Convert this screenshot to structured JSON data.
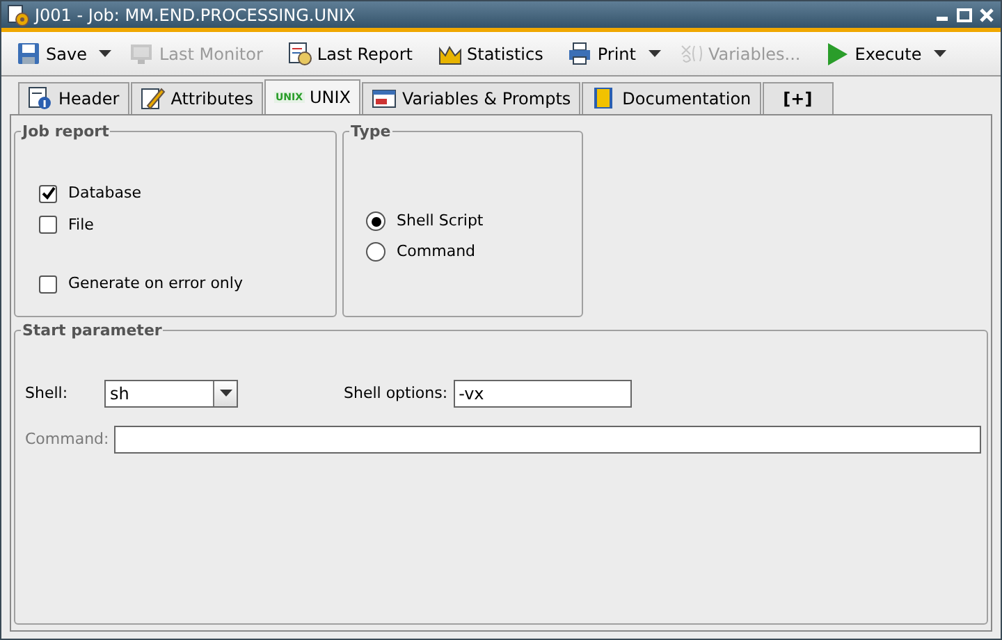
{
  "window": {
    "title": "J001 - Job: MM.END.PROCESSING.UNIX"
  },
  "toolbar": [
    {
      "label": "Save",
      "disabled": false,
      "dropdown": true
    },
    {
      "label": "Last Monitor",
      "disabled": true,
      "dropdown": false
    },
    {
      "label": "Last Report",
      "disabled": false,
      "dropdown": false
    },
    {
      "label": "Statistics",
      "disabled": false,
      "dropdown": false
    },
    {
      "label": "Print",
      "disabled": false,
      "dropdown": true
    },
    {
      "label": "Variables...",
      "disabled": true,
      "dropdown": false
    },
    {
      "label": "Execute",
      "disabled": false,
      "dropdown": true
    }
  ],
  "tabs": [
    {
      "label": "Header",
      "selected": false
    },
    {
      "label": "Attributes",
      "selected": false
    },
    {
      "label": "UNIX",
      "badge": "UNIX",
      "selected": true
    },
    {
      "label": "Variables & Prompts",
      "selected": false
    },
    {
      "label": "Documentation",
      "selected": false
    },
    {
      "label": "[+]",
      "selected": false
    }
  ],
  "job_report": {
    "title": "Job report",
    "report_to": [
      {
        "label": "Database",
        "checked": true
      },
      {
        "label": "File",
        "checked": false
      }
    ],
    "generate_on_error": {
      "label": "Generate on error only",
      "checked": false
    }
  },
  "type": {
    "title": "Type",
    "options": [
      {
        "label": "Shell Script",
        "selected": true
      },
      {
        "label": "Command",
        "selected": false
      }
    ]
  },
  "start_parameter": {
    "title": "Start parameter",
    "shell": {
      "label": "Shell:",
      "value": "sh"
    },
    "shell_options": {
      "label": "Shell options:",
      "value": "-vx"
    },
    "command": {
      "label": "Command:",
      "disabled": true
    }
  }
}
